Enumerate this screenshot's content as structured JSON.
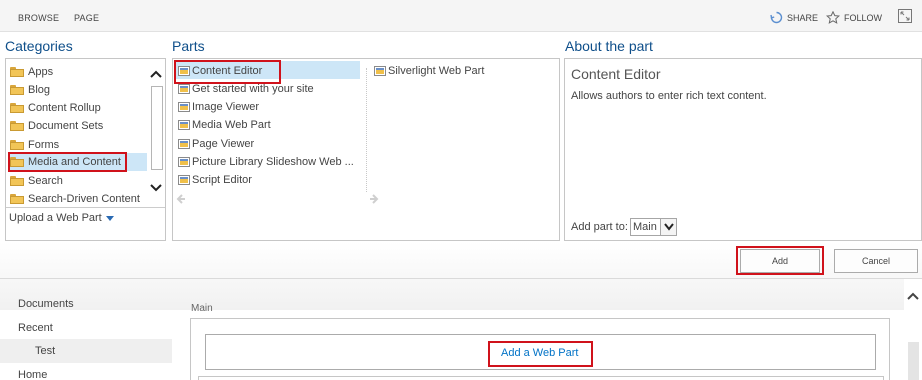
{
  "ribbon": {
    "tabs": [
      "BROWSE",
      "PAGE"
    ],
    "share_label": "SHARE",
    "follow_label": "FOLLOW"
  },
  "categories": {
    "title": "Categories",
    "items": [
      "Apps",
      "Blog",
      "Content Rollup",
      "Document Sets",
      "Forms",
      "Media and Content",
      "Search",
      "Search-Driven Content"
    ],
    "selected": "Media and Content",
    "upload_label": "Upload a Web Part"
  },
  "parts": {
    "title": "Parts",
    "column1": [
      "Content Editor",
      "Get started with your site",
      "Image Viewer",
      "Media Web Part",
      "Page Viewer",
      "Picture Library Slideshow Web ...",
      "Script Editor"
    ],
    "column2": [
      "Silverlight Web Part"
    ],
    "selected": "Content Editor"
  },
  "about": {
    "title": "About the part",
    "part_name": "Content Editor",
    "description": "Allows authors to enter rich text content.",
    "add_part_to_label": "Add part to:",
    "add_part_to_value": "Main"
  },
  "buttons": {
    "add": "Add",
    "cancel": "Cancel"
  },
  "nav": {
    "items": [
      "Documents",
      "Recent",
      "Test",
      "Home"
    ],
    "selected": "Test"
  },
  "zone": {
    "label": "Main",
    "add_web_part": "Add a Web Part"
  },
  "colors": {
    "accent": "#0072c6",
    "highlight_outline": "#d0121b",
    "selection": "#cde6f7",
    "section_title": "#0f4f8a"
  }
}
